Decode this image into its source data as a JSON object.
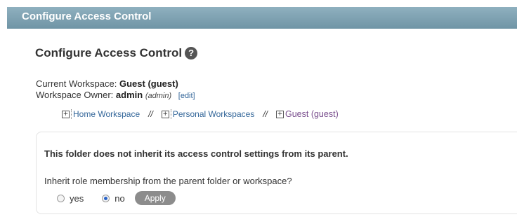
{
  "header": {
    "title": "Configure Access Control"
  },
  "section": {
    "title": "Configure Access Control",
    "help_icon": "question-circle-icon"
  },
  "workspace": {
    "current_label": "Current Workspace:",
    "current_value": "Guest (guest)",
    "owner_label": "Workspace Owner:",
    "owner_name": "admin",
    "owner_id": "(admin)",
    "edit_link": "[edit]"
  },
  "breadcrumb": {
    "items": [
      "Home Workspace",
      "Personal Workspaces",
      "Guest (guest)"
    ],
    "separator": "//"
  },
  "panel": {
    "message": "This folder does not inherit its access control settings from its parent.",
    "question": "Inherit role membership from the parent folder or workspace?",
    "options": [
      "yes",
      "no"
    ],
    "selected": "no",
    "apply_label": "Apply"
  },
  "colors": {
    "header": "#7a9fb0",
    "link": "#336699",
    "current_crumb": "#7a4f8e",
    "button": "#8c8c8c"
  }
}
